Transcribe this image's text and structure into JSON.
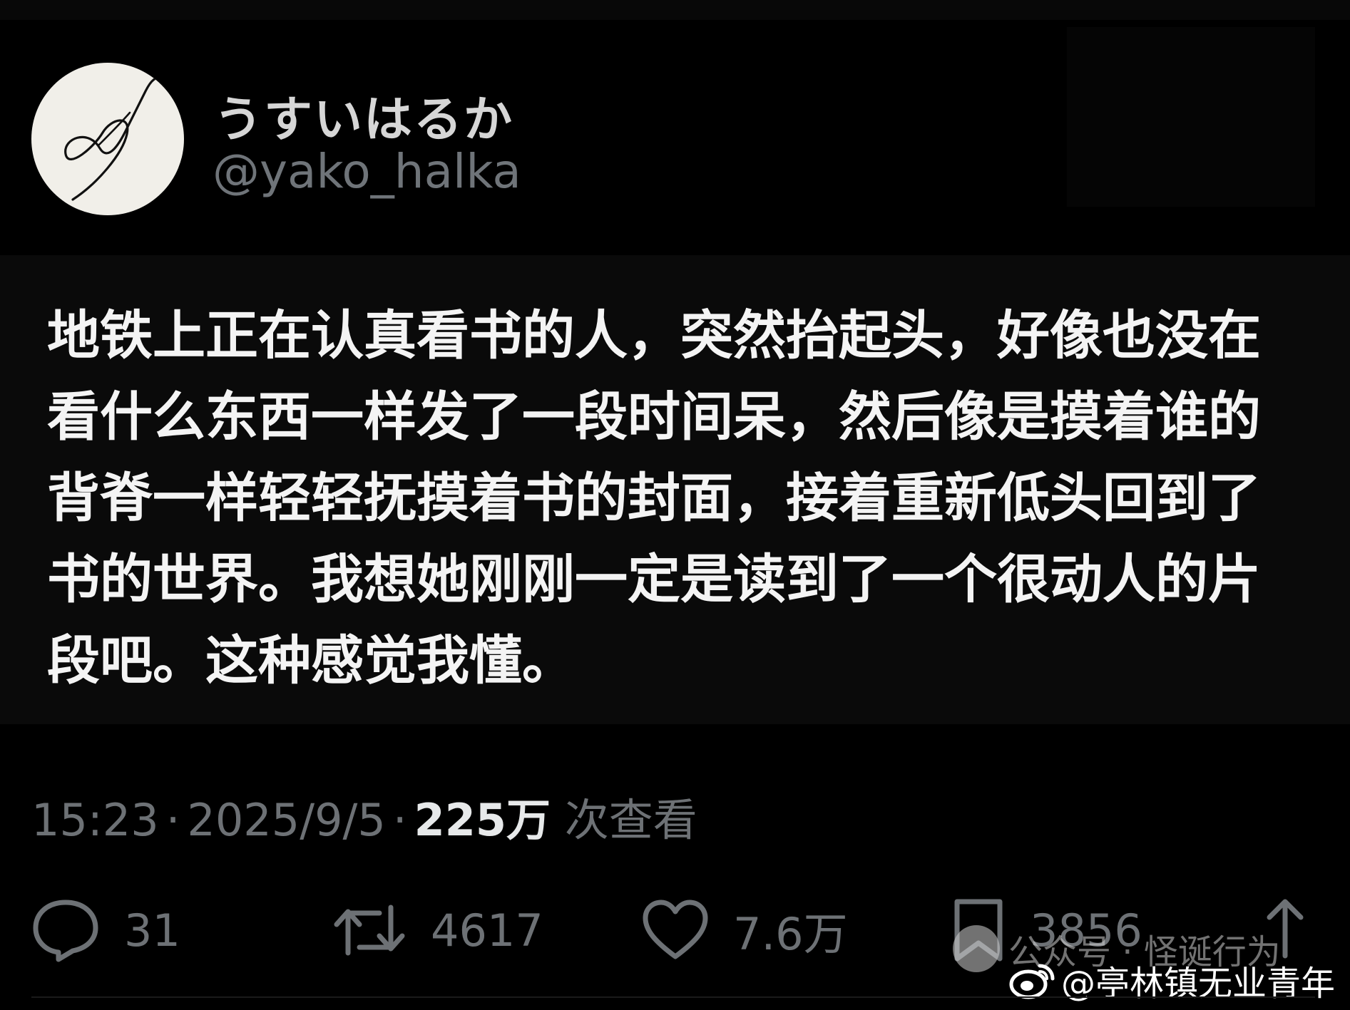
{
  "user": {
    "display_name": "うすいはるか",
    "handle": "@yako_halka",
    "avatar_icon": "signature-scribble-avatar"
  },
  "post": {
    "lines": [
      "地铁上正在认真看书的人，突然抬起头，好像也没在",
      "看什么东西一样发了一段时间呆，然后像是摸着谁的",
      "背脊一样轻轻抚摸着书的封面，接着重新低头回到了",
      "书的世界。我想她刚刚一定是读到了一个很动人的片",
      "段吧。这种感觉我懂。"
    ]
  },
  "meta": {
    "time": "15:23",
    "date": "2025/9/5",
    "views_count": "225万",
    "views_label": "次查看",
    "separator": "·"
  },
  "actions": {
    "replies": {
      "icon": "reply-icon",
      "count": "31"
    },
    "reposts": {
      "icon": "repost-icon",
      "count": "4617"
    },
    "likes": {
      "icon": "heart-icon",
      "count": "7.6万"
    },
    "bookmarks": {
      "icon": "bookmark-icon",
      "count": "3856"
    },
    "share": {
      "icon": "share-icon"
    }
  },
  "watermarks": {
    "wechat": "公众号 · 怪诞行为",
    "weibo": "@亭林镇无业青年"
  },
  "colors": {
    "background": "#000000",
    "text_primary": "#f4f4f4",
    "text_secondary": "#6d7175"
  }
}
